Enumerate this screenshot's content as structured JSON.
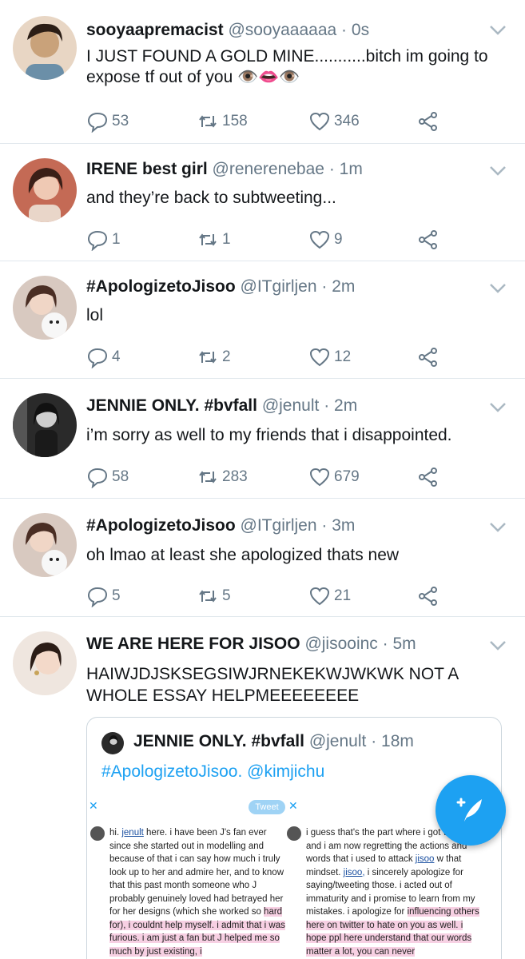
{
  "tweets": [
    {
      "name": "sooyaapremacist",
      "handle": "@sooyaaaaaa",
      "time": "0s",
      "text": "I JUST FOUND A GOLD MINE...........bitch im going to expose tf out of you 👁️👄👁️",
      "replies": "53",
      "retweets": "158",
      "likes": "346",
      "avatar_color": "#c9a27a"
    },
    {
      "name": "IRENE best girl",
      "handle": "@renerenebae",
      "time": "1m",
      "text": "and they’re back to subtweeting...",
      "replies": "1",
      "retweets": "1",
      "likes": "9",
      "avatar_color": "#d38a72"
    },
    {
      "name": "#ApologizetoJisoo",
      "handle": "@ITgirljen",
      "time": "2m",
      "text": "lol",
      "replies": "4",
      "retweets": "2",
      "likes": "12",
      "avatar_color": "#b89a8a"
    },
    {
      "name": "JENNIE ONLY. #bvfall",
      "handle": "@jenult",
      "time": "2m",
      "text": "i’m sorry as well to my friends that i disappointed.",
      "replies": "58",
      "retweets": "283",
      "likes": "679",
      "avatar_color": "#3a3a3a"
    },
    {
      "name": "#ApologizetoJisoo",
      "handle": "@ITgirljen",
      "time": "3m",
      "text": "oh lmao at least she apologized thats new",
      "replies": "5",
      "retweets": "5",
      "likes": "21",
      "avatar_color": "#b89a8a"
    },
    {
      "name": "WE ARE HERE FOR JISOO",
      "handle": "@jisooinc",
      "time": "5m",
      "text": "HAIWJDJSKSEGSIWJRNEKEKWJWKWK NOT A WHOLE ESSAY HELPMEEEEEEEE",
      "avatar_color": "#d9c2b5"
    }
  ],
  "quote": {
    "name": "JENNIE ONLY. #bvfall",
    "handle": "@jenult",
    "time": "18m",
    "text": "#ApologizetoJisoo. @kimjichu",
    "image": {
      "pill": "Tweet",
      "x_mark": "✕",
      "left_column": {
        "p1": "hi. ",
        "p1_link": "jenult",
        "p2": " here. i have been J's fan ever since she started out in modelling and because of that i can say how much i truly look up to her and admire her, and to know that this past month someone who J probably genuinely loved had betrayed her for her designs (which she worked so ",
        "p3_hl": "hard for), i couldnt help myself. i admit that i was furious. i am just a fan but J helped me so much by just existing, i"
      },
      "right_column": {
        "p1": "i guess that's the part where i got wrong, and i am now regretting the actions and words that i used to attack ",
        "p1_link": "jisoo",
        "p2": " w that mindset. ",
        "p2_link": "jisoo,",
        "p3": " i sincerely apologize for saying/tweeting those. i acted out of immaturity and i promise to learn from my mistakes. i apologize for ",
        "p4_hl": "influencing others here on twitter to hate on you as well. i hope ppl here understand that our words matter a lot, you can never"
      }
    }
  },
  "colors": {
    "accent": "#1da1f2",
    "muted": "#657786",
    "divider": "#e1e8ed"
  },
  "icons": {
    "reply": "reply-icon",
    "retweet": "retweet-icon",
    "like": "heart-icon",
    "share": "share-icon",
    "menu": "chevron-down-icon",
    "compose": "compose-tweet-icon"
  }
}
